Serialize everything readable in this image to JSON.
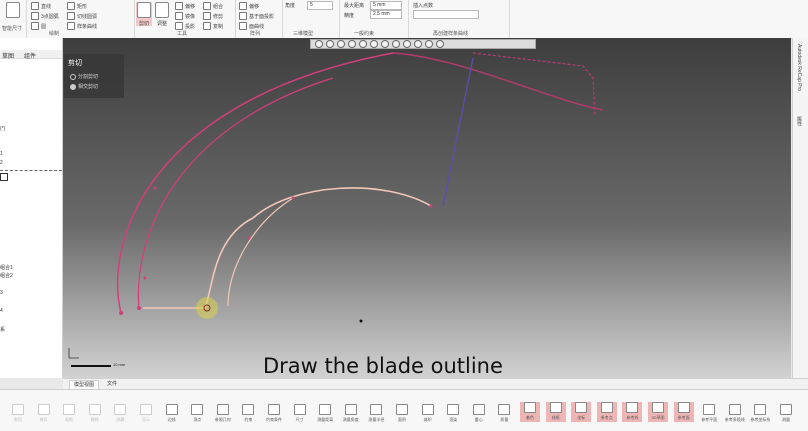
{
  "ribbon": {
    "items_left": [
      "直线",
      "矩形",
      "3点圆弧",
      "切线圆弧",
      "圆",
      "样条曲线"
    ],
    "big_buttons": [
      {
        "label": "剪切",
        "active": true
      },
      {
        "label": "调整",
        "active": false
      }
    ],
    "tool_items": [
      "偏移",
      "镜像",
      "投影",
      "组合",
      "修剪",
      "复制",
      "移动",
      "旋转"
    ],
    "create_items": [
      "偏移",
      "基于面投影",
      "面曲线"
    ],
    "field_values": {
      "f1": "5",
      "f2": "5 mm",
      "f3": "2.5 mm"
    },
    "field_labels": {
      "angle": "角度",
      "width": "最大距离",
      "height": "精度",
      "tol": "插入点数"
    },
    "group_labels": [
      "绘制",
      "工具",
      "阵列",
      "三维模型",
      "一般约束",
      "再创建样条曲线"
    ],
    "top_left_label": "智能尺寸"
  },
  "left_panel": {
    "tabs": [
      "草图",
      "组件"
    ],
    "tree_items": [
      "(*)",
      "1",
      "2",
      "组合1",
      "组合2",
      "3",
      "4",
      "系"
    ]
  },
  "viewport": {
    "cut_panel": {
      "title": "剪切",
      "options": [
        "分割剪切",
        "相交剪切"
      ],
      "selected_option": 1
    },
    "subtitle": "Draw the blade outline",
    "scale_text": "10 mm"
  },
  "right_strip": {
    "texts": [
      "Autodesk ReCap Pro",
      "属性"
    ]
  },
  "tabs": {
    "items": [
      "模型视图",
      "文件"
    ],
    "selected": 0
  },
  "bottom_toolbar": {
    "buttons": [
      {
        "label": "剪切"
      },
      {
        "label": "拷贝"
      },
      {
        "label": "粘贴"
      },
      {
        "label": "删除"
      },
      {
        "label": "隐藏"
      },
      {
        "label": "显示"
      },
      {
        "label": "边线"
      },
      {
        "label": "顶点"
      },
      {
        "label": "参照几何"
      },
      {
        "label": "约束"
      },
      {
        "label": "约束条件"
      },
      {
        "label": "尺寸"
      },
      {
        "label": "测量距离"
      },
      {
        "label": "测量角度"
      },
      {
        "label": "测量半径"
      },
      {
        "label": "面积"
      },
      {
        "label": "体积"
      },
      {
        "label": "渲染"
      },
      {
        "label": "重心"
      },
      {
        "label": "质量"
      },
      {
        "label": "着色"
      },
      {
        "label": "线框"
      },
      {
        "label": "坐标"
      },
      {
        "label": "参考点"
      },
      {
        "label": "参考线"
      },
      {
        "label": "3D草图"
      },
      {
        "label": "参考面"
      },
      {
        "label": "参考平面"
      },
      {
        "label": "参考多段线"
      },
      {
        "label": "参考坐标系"
      },
      {
        "label": "测量"
      }
    ]
  },
  "colors": {
    "sketch_primary": "#d23f7a",
    "sketch_secondary": "#f1c7b7",
    "sketch_line": "#6a5ab5",
    "highlight": "#eeb5b5",
    "cursor_ring": "#d8d24a"
  }
}
